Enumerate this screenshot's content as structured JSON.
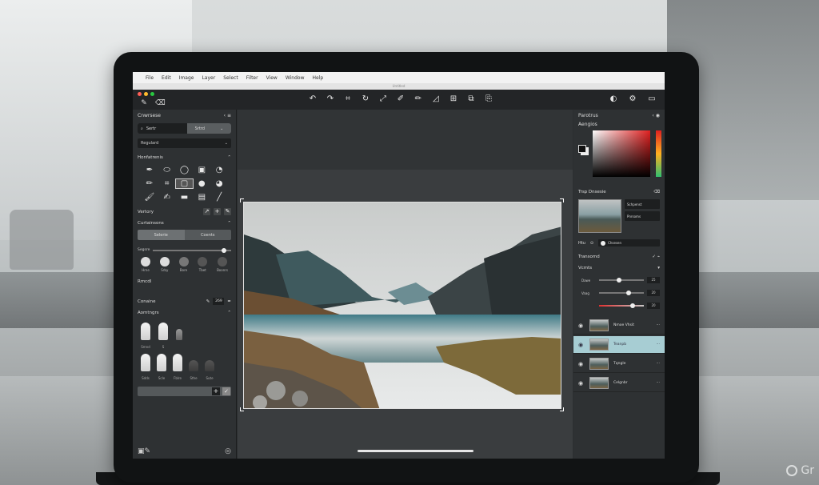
{
  "menubar": {
    "items": [
      "File",
      "Edit",
      "Image",
      "Layer",
      "Select",
      "Filter",
      "View",
      "Window",
      "Help"
    ],
    "title": "Untitled"
  },
  "left_panel": {
    "header": "Cnwrsese",
    "search_label": "Sertr",
    "mode_label": "Srtrd",
    "dropdown_value": "Regulard",
    "tools_title": "Honfatrenis",
    "history_label": "Vertory",
    "curtains_title": "Curtainsons",
    "seg_a": "Selerie",
    "seg_b": "Coents",
    "size_label": "Segsre",
    "brush_labels": [
      "Hrne",
      "Srby",
      "Bore",
      "Tbet",
      "Boonrs"
    ],
    "remote_label": "Rmcdl",
    "color_label": "Conaine",
    "color_value": "269",
    "presets_title": "Aomtngrs",
    "preset_labels_top": [
      "Smnd",
      "S",
      ""
    ],
    "preset_labels_bottom": [
      "Sdds",
      "Scle",
      "Fblre",
      "Sthe",
      "Sute"
    ]
  },
  "right_panel": {
    "header": "Parotrus",
    "color_title": "Aengios",
    "top_title": "Trsp Dnsesie",
    "top_values": [
      "Schpenst",
      "Pnrsoms"
    ],
    "fx_label": "Htu",
    "fx_value": "Chsesen",
    "transform_title": "Transomd",
    "layers_title": "Vcmts",
    "slider_labels": [
      "Dawe",
      "Vaag",
      ""
    ],
    "slider_values": [
      "25",
      "20",
      "20"
    ],
    "layers": [
      {
        "name": "Nmoe Vhsit",
        "active": false
      },
      {
        "name": "Teanpb",
        "active": true
      },
      {
        "name": "Tqngle",
        "active": false
      },
      {
        "name": "Celgnbr",
        "active": false
      }
    ]
  },
  "watermark": "Gr"
}
